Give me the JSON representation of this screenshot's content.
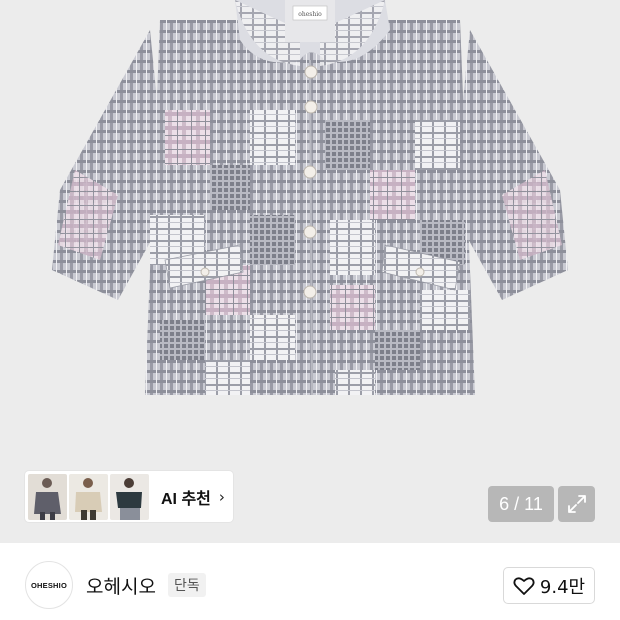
{
  "product": {
    "image_alt": "patchwork plaid jacket",
    "tag_text": "oheshio"
  },
  "ai_recommend": {
    "label": "AI 추천",
    "chevron": "›"
  },
  "gallery": {
    "counter": "6 / 11"
  },
  "brand": {
    "logo_text": "OHESHIO",
    "name": "오헤시오",
    "badge": "단독"
  },
  "like": {
    "count": "9.4만"
  },
  "icons": {
    "expand": "expand-icon",
    "heart": "heart-icon",
    "chevron": "chevron-right-icon"
  },
  "colors": {
    "hero_bg": "#ececec",
    "plaid_gray": "#9a9ca6",
    "plaid_pink": "#d7c6d3",
    "plaid_light": "#e4e4ea"
  }
}
